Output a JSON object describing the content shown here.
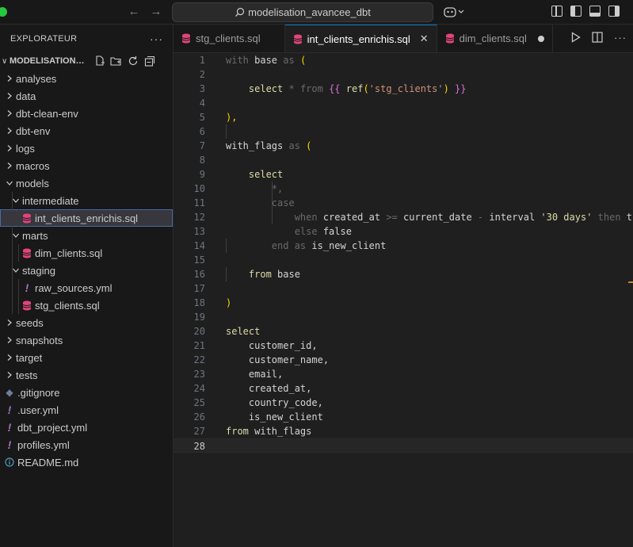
{
  "titlebar": {
    "search_text": "modelisation_avancee_dbt",
    "back_icon": "arrow-left-icon",
    "forward_icon": "arrow-right-icon"
  },
  "sidebar": {
    "title": "EXPLORATEUR",
    "more": "···",
    "folder_name": "MODELISATION_AVANCEE_DBT",
    "tree": [
      {
        "label": "analyses",
        "type": "folder",
        "expanded": false,
        "depth": 0
      },
      {
        "label": "data",
        "type": "folder",
        "expanded": false,
        "depth": 0
      },
      {
        "label": "dbt-clean-env",
        "type": "folder",
        "expanded": false,
        "depth": 0
      },
      {
        "label": "dbt-env",
        "type": "folder",
        "expanded": false,
        "depth": 0
      },
      {
        "label": "logs",
        "type": "folder",
        "expanded": false,
        "depth": 0
      },
      {
        "label": "macros",
        "type": "folder",
        "expanded": false,
        "depth": 0
      },
      {
        "label": "models",
        "type": "folder",
        "expanded": true,
        "depth": 0
      },
      {
        "label": "intermediate",
        "type": "folder",
        "expanded": true,
        "depth": 1
      },
      {
        "label": "int_clients_enrichis.sql",
        "type": "sql",
        "depth": 2,
        "selected": true
      },
      {
        "label": "marts",
        "type": "folder",
        "expanded": true,
        "depth": 1
      },
      {
        "label": "dim_clients.sql",
        "type": "sql",
        "depth": 2
      },
      {
        "label": "staging",
        "type": "folder",
        "expanded": true,
        "depth": 1
      },
      {
        "label": "raw_sources.yml",
        "type": "yml",
        "depth": 2
      },
      {
        "label": "stg_clients.sql",
        "type": "sql",
        "depth": 2
      },
      {
        "label": "seeds",
        "type": "folder",
        "expanded": false,
        "depth": 0
      },
      {
        "label": "snapshots",
        "type": "folder",
        "expanded": false,
        "depth": 0
      },
      {
        "label": "target",
        "type": "folder",
        "expanded": false,
        "depth": 0
      },
      {
        "label": "tests",
        "type": "folder",
        "expanded": false,
        "depth": 0
      },
      {
        "label": ".gitignore",
        "type": "git",
        "depth": 0
      },
      {
        "label": ".user.yml",
        "type": "yml",
        "depth": 0
      },
      {
        "label": "dbt_project.yml",
        "type": "yml",
        "depth": 0
      },
      {
        "label": "profiles.yml",
        "type": "yml",
        "depth": 0
      },
      {
        "label": "README.md",
        "type": "info",
        "depth": 0
      }
    ]
  },
  "tabs": [
    {
      "label": "stg_clients.sql",
      "active": false,
      "state": "none"
    },
    {
      "label": "int_clients_enrichis.sql",
      "active": true,
      "state": "close"
    },
    {
      "label": "dim_clients.sql",
      "active": false,
      "state": "dirty"
    }
  ],
  "editor": {
    "current_line": 28,
    "lines": [
      [
        {
          "t": "with ",
          "c": "dim"
        },
        {
          "t": "base",
          "c": "tx"
        },
        {
          "t": " as ",
          "c": "dim"
        },
        {
          "t": "(",
          "c": "br"
        }
      ],
      [],
      [
        {
          "t": "    select ",
          "c": "fn"
        },
        {
          "t": "* ",
          "c": "dim"
        },
        {
          "t": "from ",
          "c": "dim"
        },
        {
          "t": "{{ ",
          "c": "br2"
        },
        {
          "t": "ref",
          "c": "fn"
        },
        {
          "t": "(",
          "c": "br"
        },
        {
          "t": "'stg_clients'",
          "c": "str"
        },
        {
          "t": ")",
          "c": "br"
        },
        {
          "t": " }}",
          "c": "br2"
        }
      ],
      [],
      [
        {
          "t": "),",
          "c": "br"
        }
      ],
      [],
      [
        {
          "t": "with_flags",
          "c": "tx"
        },
        {
          "t": " as ",
          "c": "dim"
        },
        {
          "t": "(",
          "c": "br"
        }
      ],
      [],
      [
        {
          "t": "    select",
          "c": "fn"
        }
      ],
      [
        {
          "t": "        *,",
          "c": "dim"
        }
      ],
      [
        {
          "t": "        case",
          "c": "dim"
        }
      ],
      [
        {
          "t": "            when ",
          "c": "dim"
        },
        {
          "t": "created_at ",
          "c": "tx"
        },
        {
          "t": ">= ",
          "c": "dim"
        },
        {
          "t": "current_date ",
          "c": "tx"
        },
        {
          "t": "- ",
          "c": "dim"
        },
        {
          "t": "interval ",
          "c": "tx"
        },
        {
          "t": "'30 days'",
          "c": "fn"
        },
        {
          "t": " then ",
          "c": "dim"
        },
        {
          "t": "true",
          "c": "tx"
        }
      ],
      [
        {
          "t": "            else ",
          "c": "dim"
        },
        {
          "t": "false",
          "c": "tx"
        }
      ],
      [
        {
          "t": "        end ",
          "c": "dim"
        },
        {
          "t": "as ",
          "c": "dim"
        },
        {
          "t": "is_new_client",
          "c": "tx"
        }
      ],
      [],
      [
        {
          "t": "    from ",
          "c": "fn"
        },
        {
          "t": "base",
          "c": "tx"
        }
      ],
      [],
      [
        {
          "t": ")",
          "c": "br"
        }
      ],
      [],
      [
        {
          "t": "select",
          "c": "fn"
        }
      ],
      [
        {
          "t": "    customer_id,",
          "c": "tx"
        }
      ],
      [
        {
          "t": "    customer_name,",
          "c": "tx"
        }
      ],
      [
        {
          "t": "    email,",
          "c": "tx"
        }
      ],
      [
        {
          "t": "    created_at,",
          "c": "tx"
        }
      ],
      [
        {
          "t": "    country_code,",
          "c": "tx"
        }
      ],
      [
        {
          "t": "    is_new_client",
          "c": "tx"
        }
      ],
      [
        {
          "t": "from ",
          "c": "fn"
        },
        {
          "t": "with_flags",
          "c": "tx"
        }
      ],
      []
    ]
  },
  "colors": {
    "accent": "#0078d4",
    "sql_icon": "#e0457b",
    "yml_icon": "#a074c4",
    "bracket_gold": "#ffd700",
    "keyword_yellow": "#dcdcaa",
    "string_yellow": "#dcdcaa"
  }
}
